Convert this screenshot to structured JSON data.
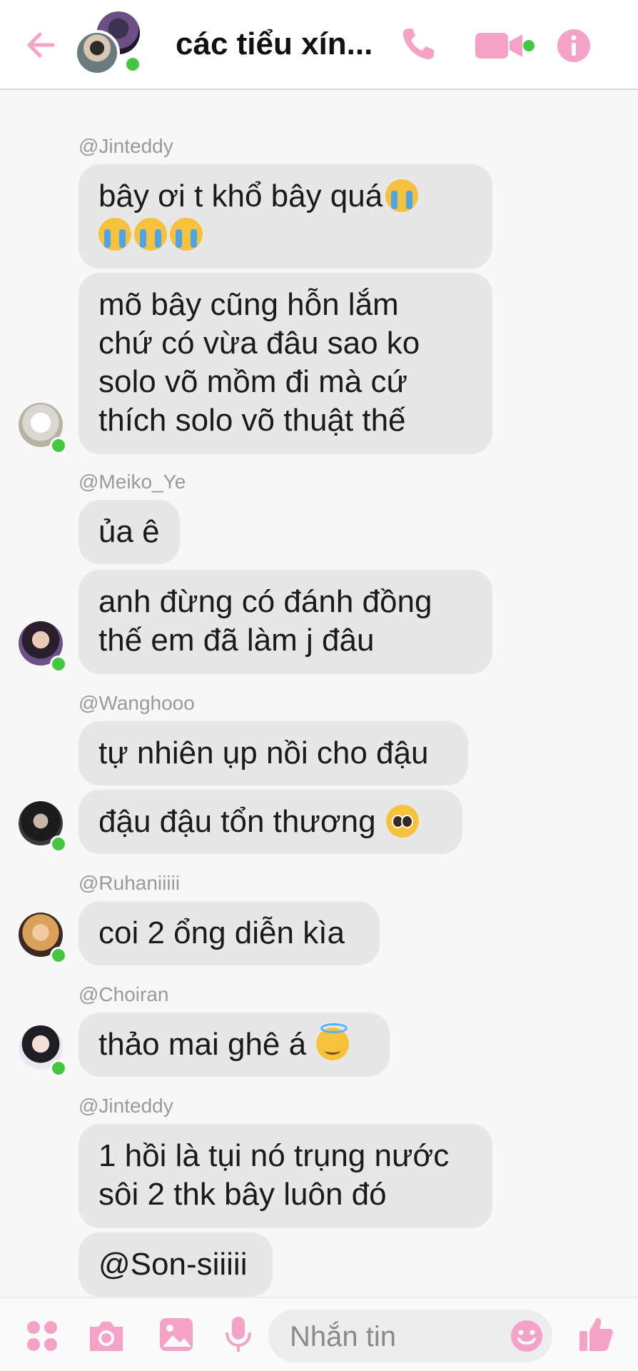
{
  "header": {
    "title": "các tiểu xín..."
  },
  "messages": [
    {
      "sender": "@Jinteddy",
      "bubbles": [
        {
          "lines": [
            "bây ơi t khổ bây quá"
          ]
        },
        {
          "lines": [
            "mõ bây cũng hỗn lắm",
            "chứ có vừa đâu sao ko",
            "solo võ mồm đi mà cứ",
            "thích solo võ thuật thế"
          ]
        }
      ]
    },
    {
      "sender": "@Meiko_Ye",
      "bubbles": [
        {
          "lines": [
            "ủa ê"
          ]
        },
        {
          "lines": [
            "anh đừng có đánh đồng",
            "thế em đã làm j đâu"
          ]
        }
      ]
    },
    {
      "sender": "@Wanghooo",
      "bubbles": [
        {
          "lines": [
            "tự nhiên ụp nồi cho đậu"
          ]
        },
        {
          "lines": [
            "đậu đậu tổn thương"
          ]
        }
      ]
    },
    {
      "sender": "@Ruhaniiiii",
      "bubbles": [
        {
          "lines": [
            "coi 2 ổng diễn kìa"
          ]
        }
      ]
    },
    {
      "sender": "@Choiran",
      "bubbles": [
        {
          "lines": [
            "thảo mai ghê á"
          ]
        }
      ]
    },
    {
      "sender": "@Jinteddy",
      "bubbles": [
        {
          "lines": [
            "1 hồi là tụi nó trụng nước",
            "sôi 2 thk bây luôn đó"
          ]
        },
        {
          "lines": [
            "@Son-siiiii"
          ]
        }
      ]
    }
  ],
  "composer": {
    "placeholder": "Nhắn tin"
  },
  "icons": {
    "back": "arrow-left-icon",
    "call": "phone-icon",
    "video": "video-camera-icon",
    "info": "info-icon",
    "apps": "four-dots-icon",
    "camera": "camera-icon",
    "gallery": "image-icon",
    "mic": "microphone-icon",
    "emoji": "smiley-icon",
    "like": "thumbs-up-icon"
  },
  "colors": {
    "accent": "#f4a3c7",
    "bubble": "#e7e7e7",
    "online": "#44c740"
  }
}
